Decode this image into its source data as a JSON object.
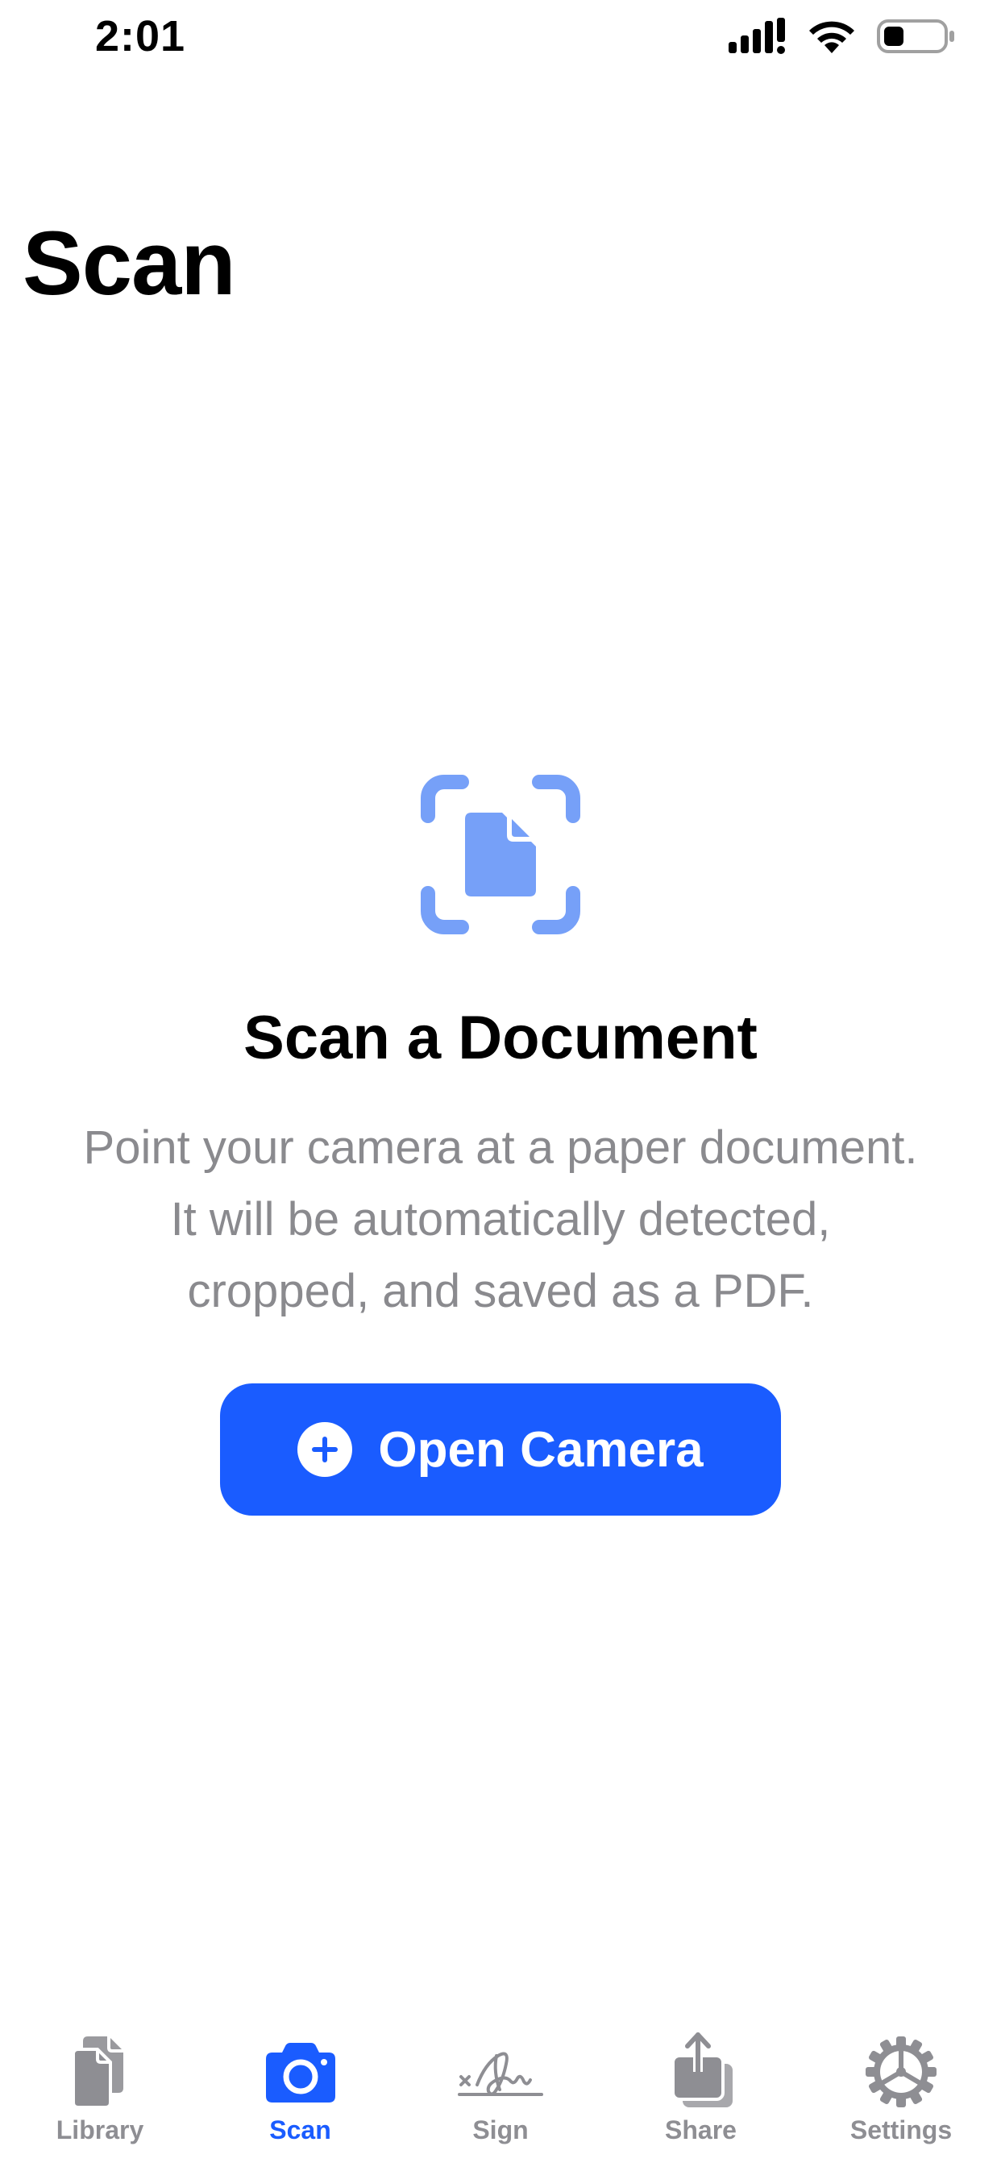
{
  "status_bar": {
    "time": "2:01",
    "icons": [
      "cellular-signal-icon",
      "wifi-icon",
      "battery-icon"
    ]
  },
  "page": {
    "title": "Scan"
  },
  "empty_state": {
    "icon": "scan-document-icon",
    "heading": "Scan a Document",
    "description": "Point your camera at a paper document. It will be automatically detected, cropped, and saved as a PDF.",
    "button_label": "Open Camera",
    "button_icon": "plus-circle-icon"
  },
  "tab_bar": {
    "items": [
      {
        "label": "Library",
        "icon": "documents-icon",
        "active": false
      },
      {
        "label": "Scan",
        "icon": "camera-icon",
        "active": true
      },
      {
        "label": "Sign",
        "icon": "signature-icon",
        "active": false
      },
      {
        "label": "Share",
        "icon": "share-icon",
        "active": false
      },
      {
        "label": "Settings",
        "icon": "gear-icon",
        "active": false
      }
    ]
  },
  "colors": {
    "accent": "#1a5cff",
    "icon_light_accent": "#76a0f8",
    "inactive": "#8e8e93",
    "secondary_text": "#8a8a8e"
  }
}
